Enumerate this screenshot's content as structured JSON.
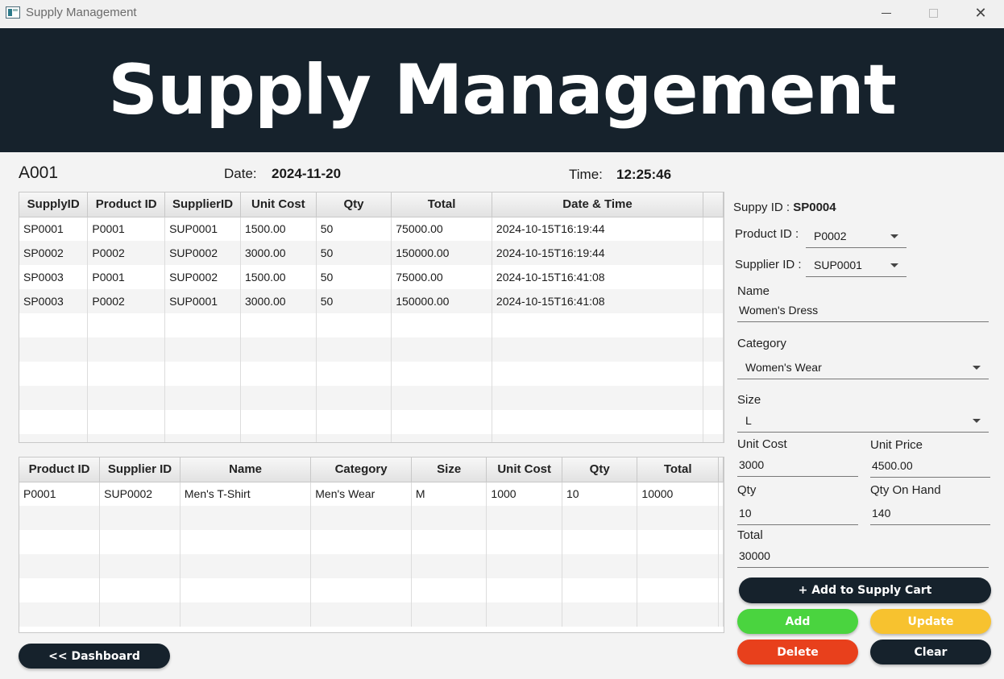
{
  "window": {
    "title": "Supply Management"
  },
  "banner": {
    "title": "Supply Management"
  },
  "header": {
    "user_id": "A001",
    "date_label": "Date:",
    "date_value": "2024-11-20",
    "time_label": "Time:",
    "time_value": "12:25:46"
  },
  "supply_table": {
    "columns": [
      "SupplyID",
      "Product ID",
      "SupplierID",
      "Unit Cost",
      "Qty",
      "Total",
      "Date & Time"
    ],
    "rows": [
      [
        "SP0001",
        "P0001",
        "SUP0001",
        "1500.00",
        "50",
        "75000.00",
        "2024-10-15T16:19:44"
      ],
      [
        "SP0002",
        "P0002",
        "SUP0002",
        "3000.00",
        "50",
        "150000.00",
        "2024-10-15T16:19:44"
      ],
      [
        "SP0003",
        "P0001",
        "SUP0002",
        "1500.00",
        "50",
        "75000.00",
        "2024-10-15T16:41:08"
      ],
      [
        "SP0003",
        "P0002",
        "SUP0001",
        "3000.00",
        "50",
        "150000.00",
        "2024-10-15T16:41:08"
      ]
    ]
  },
  "cart_table": {
    "columns": [
      "Product ID",
      "Supplier ID",
      "Name",
      "Category",
      "Size",
      "Unit Cost",
      "Qty",
      "Total"
    ],
    "rows": [
      [
        "P0001",
        "SUP0002",
        "Men's T-Shirt",
        "Men's Wear",
        "M",
        "1000",
        "10",
        "10000"
      ]
    ]
  },
  "form": {
    "supply_id_label": "Suppy ID :",
    "supply_id_value": "SP0004",
    "product_id_label": "Product ID :",
    "product_id_value": "P0002",
    "supplier_id_label": "Supplier ID :",
    "supplier_id_value": "SUP0001",
    "name_label": "Name",
    "name_value": "Women's Dress",
    "category_label": "Category",
    "category_value": "Women's Wear",
    "size_label": "Size",
    "size_value": "L",
    "unit_cost_label": "Unit Cost",
    "unit_cost_value": "3000",
    "unit_price_label": "Unit Price",
    "unit_price_value": "4500.00",
    "qty_label": "Qty",
    "qty_value": "10",
    "qty_on_hand_label": "Qty On Hand",
    "qty_on_hand_value": "140",
    "total_label": "Total",
    "total_value": "30000"
  },
  "buttons": {
    "add_to_cart": "+ Add to Supply Cart",
    "add": "Add",
    "update": "Update",
    "delete": "Delete",
    "clear": "Clear",
    "dashboard": "<< Dashboard"
  },
  "colors": {
    "banner_bg": "#16222c",
    "dark_button": "#16222c",
    "add_green": "#4ad43f",
    "update_yellow": "#f7c22f",
    "delete_red": "#e8401c"
  }
}
